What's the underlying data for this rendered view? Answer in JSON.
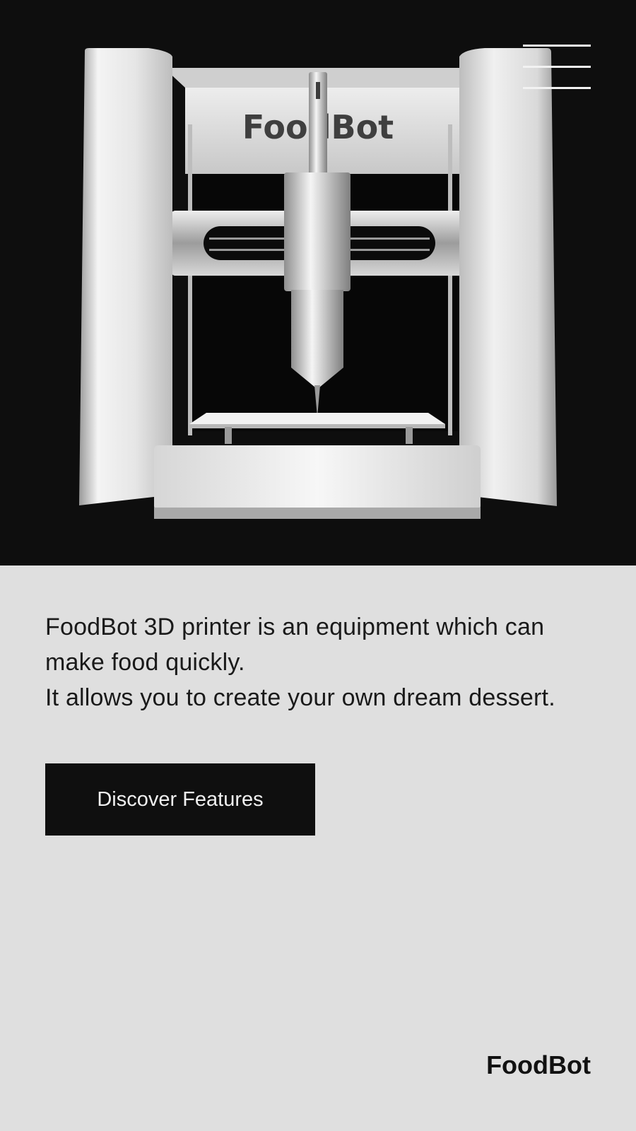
{
  "hero": {
    "product_name": "FoodBot"
  },
  "menu": {
    "icon": "hamburger-menu-icon"
  },
  "main": {
    "description_line1": "FoodBot 3D printer is an equipment which can make food quickly.",
    "description_line2": "It allows you to create your own dream dessert.",
    "cta_label": "Discover Features"
  },
  "footer": {
    "logo_text": "FoodBot"
  },
  "colors": {
    "hero_background": "#0e0e0e",
    "page_background": "#dfdfdf",
    "button_background": "#0f0f0f",
    "button_text": "#f0f0f0"
  }
}
